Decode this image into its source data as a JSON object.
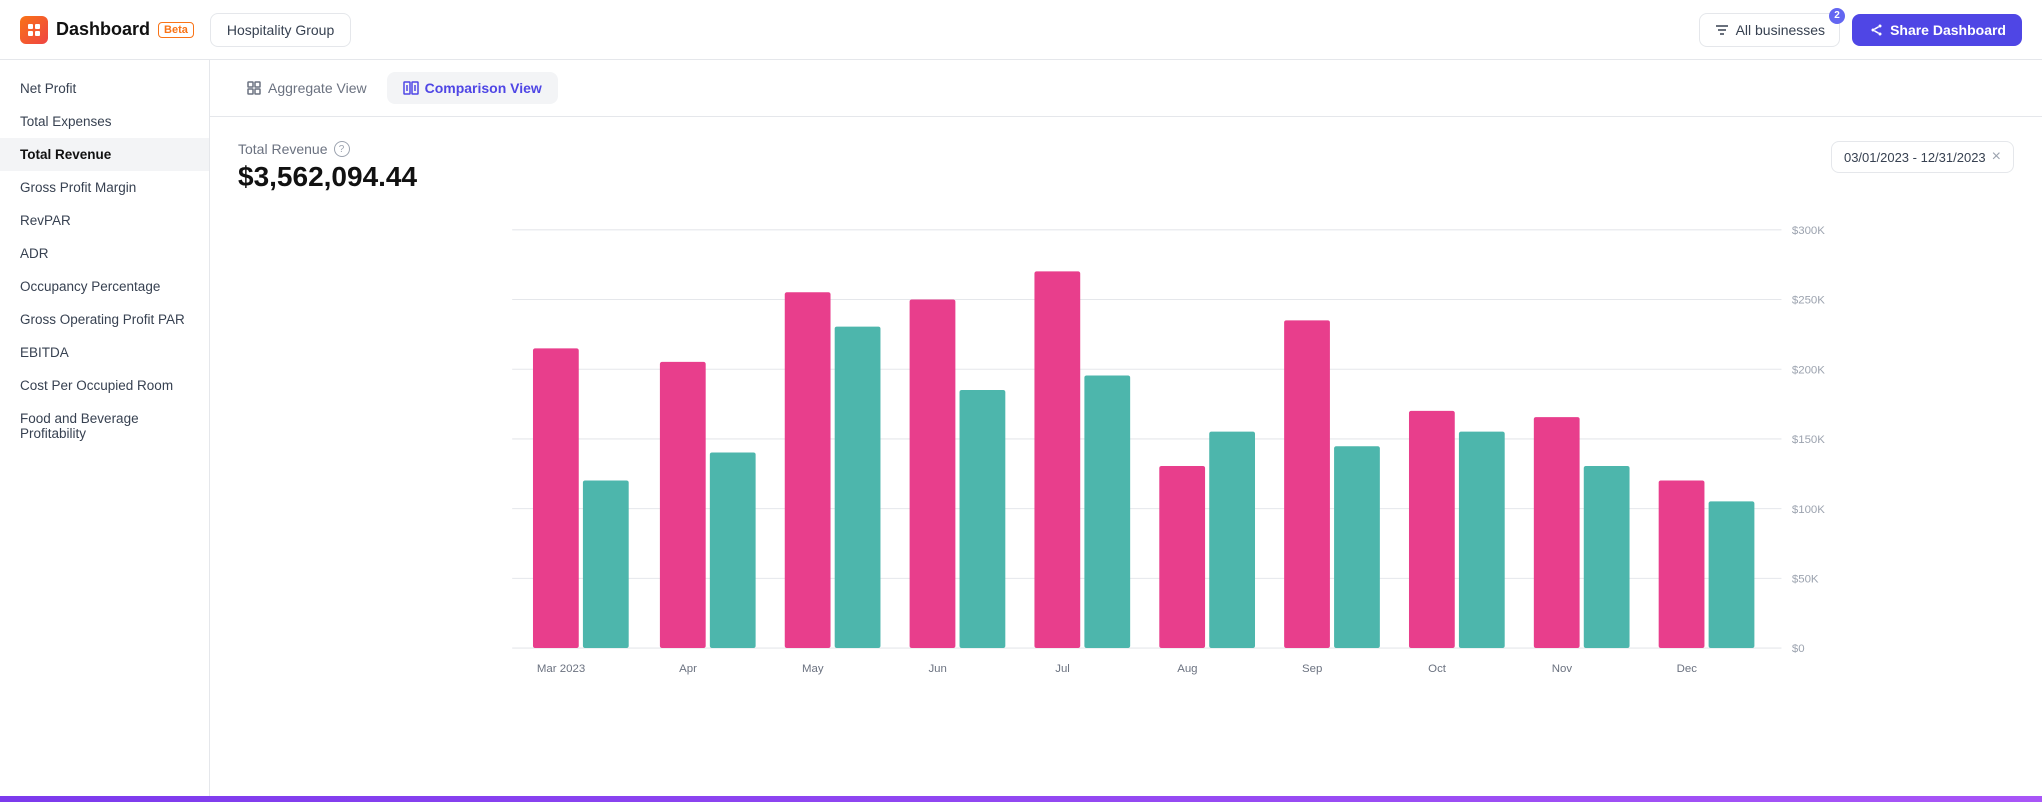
{
  "header": {
    "logo_text": "Dashboard",
    "beta_label": "Beta",
    "group_tab": "Hospitality Group",
    "all_businesses_label": "All businesses",
    "notification_count": "2",
    "share_label": "Share Dashboard"
  },
  "tabs": {
    "aggregate_label": "Aggregate View",
    "comparison_label": "Comparison View"
  },
  "sidebar": {
    "items": [
      {
        "label": "Net Profit",
        "id": "net-profit",
        "active": false
      },
      {
        "label": "Total Expenses",
        "id": "total-expenses",
        "active": false
      },
      {
        "label": "Total Revenue",
        "id": "total-revenue",
        "active": true
      },
      {
        "label": "Gross Profit Margin",
        "id": "gross-profit-margin",
        "active": false
      },
      {
        "label": "RevPAR",
        "id": "revpar",
        "active": false
      },
      {
        "label": "ADR",
        "id": "adr",
        "active": false
      },
      {
        "label": "Occupancy Percentage",
        "id": "occupancy-percentage",
        "active": false
      },
      {
        "label": "Gross Operating Profit PAR",
        "id": "gross-operating-profit-par",
        "active": false
      },
      {
        "label": "EBITDA",
        "id": "ebitda",
        "active": false
      },
      {
        "label": "Cost Per Occupied Room",
        "id": "cost-per-occupied-room",
        "active": false
      },
      {
        "label": "Food and Beverage Profitability",
        "id": "food-beverage",
        "active": false
      }
    ]
  },
  "chart": {
    "title": "Total Revenue",
    "value": "$3,562,094.44",
    "date_range": "03/01/2023 - 12/31/2023",
    "y_axis_labels": [
      "$300K",
      "$250K",
      "$200K",
      "$150K",
      "$100K",
      "$50K",
      "$0"
    ],
    "x_axis_labels": [
      "Mar 2023",
      "Apr",
      "May",
      "Jun",
      "Jul",
      "Aug",
      "Sep",
      "Oct",
      "Nov",
      "Dec"
    ],
    "bars": [
      {
        "month": "Mar 2023",
        "primary": 215,
        "secondary": 120
      },
      {
        "month": "Apr",
        "primary": 205,
        "secondary": 140
      },
      {
        "month": "May",
        "primary": 255,
        "secondary": 230
      },
      {
        "month": "Jun",
        "primary": 250,
        "secondary": 185
      },
      {
        "month": "Jul",
        "primary": 270,
        "secondary": 195
      },
      {
        "month": "Aug",
        "primary": 130,
        "secondary": 155
      },
      {
        "month": "Sep",
        "primary": 235,
        "secondary": 145
      },
      {
        "month": "Oct",
        "primary": 170,
        "secondary": 155
      },
      {
        "month": "Nov",
        "primary": 165,
        "secondary": 130
      },
      {
        "month": "Dec",
        "primary": 120,
        "secondary": 105
      }
    ],
    "colors": {
      "primary": "#e83e8c",
      "secondary": "#4db6ac"
    },
    "max_value": 300
  }
}
